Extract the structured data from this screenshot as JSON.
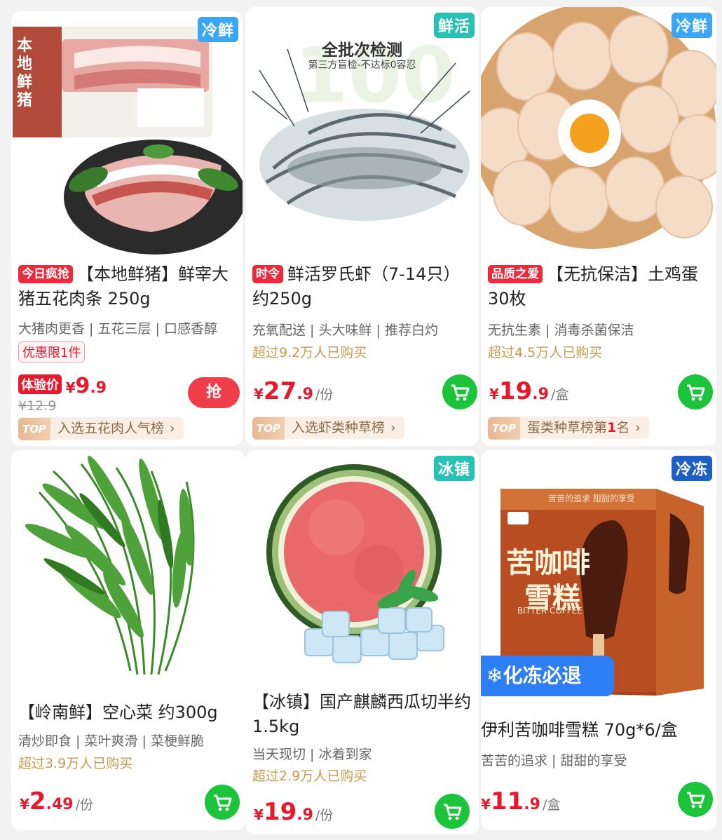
{
  "products": [
    {
      "corner_tag": "冷鲜",
      "badge": "今日疯抢",
      "title": "【本地鲜猪】鲜宰大猪五花肉条 250g",
      "subtitle": "大猪肉更香 | 五花三层 | 口感香醇",
      "limit": "优惠限1件",
      "price_label": "体验价",
      "price_yen": "¥",
      "price_int": "9",
      "price_dec": ".9",
      "price_old": "¥12.9",
      "rush_btn": "抢",
      "rank": "入选五花肉人气榜",
      "top": "TOP",
      "img_text": "本地鲜猪"
    },
    {
      "corner_tag": "鲜活",
      "badge": "时令",
      "title": "鲜活罗氏虾（7-14只） 约250g",
      "subtitle": "充氧配送 |  头大味鲜 | 推荐白灼",
      "sold": "超过9.2万人已购买",
      "price_yen": "¥",
      "price_int": "27",
      "price_dec": ".9",
      "unit": "/份",
      "rank": "入选虾类种草榜",
      "top": "TOP",
      "img_title": "全批次检测",
      "img_sub": "第三方盲检-不达标0容忍"
    },
    {
      "corner_tag": "冷鲜",
      "badge": "品质之爱",
      "title": "【无抗保洁】土鸡蛋 30枚",
      "subtitle": "无抗生素 | 消毒杀菌保洁",
      "sold": "超过4.5万人已购买",
      "price_yen": "¥",
      "price_int": "19",
      "price_dec": ".9",
      "unit": "/盒",
      "rank_pre": "蛋类种草榜第",
      "rank_num": "1",
      "rank_post": "名",
      "top": "TOP"
    },
    {
      "title": "【岭南鲜】空心菜 约300g",
      "subtitle": "清炒即食 | 菜叶爽滑 | 菜梗鲜脆",
      "sold": "超过3.9万人已购买",
      "price_yen": "¥",
      "price_int": "2",
      "price_dec": ".49",
      "unit": "/份"
    },
    {
      "corner_tag": "冰镇",
      "title": "【冰镇】国产麒麟西瓜切半约1.5kg",
      "subtitle": "当天现切 | 冰着到家",
      "sold": "超过2.9万人已购买",
      "price_yen": "¥",
      "price_int": "19",
      "price_dec": ".9",
      "unit": "/份"
    },
    {
      "corner_tag": "冷冻",
      "title": "伊利苦咖啡雪糕 70g*6/盒",
      "subtitle": "苦苦的追求 | 甜甜的享受",
      "price_yen": "¥",
      "price_int": "11",
      "price_dec": ".9",
      "unit": "/盒",
      "banner": "化冻必退",
      "box_title_1": "苦咖啡",
      "box_title_2": "雪糕",
      "box_en": "BITTER COFFEE",
      "box_top": "苦苦的追求  甜甜的享受"
    }
  ],
  "colors": {
    "price_red": "#e8192c",
    "cart_green": "#1cc43c",
    "tag_blue": "#3aa6f5",
    "tag_teal": "#27c2b4",
    "sold_gold": "#c89a4e"
  }
}
